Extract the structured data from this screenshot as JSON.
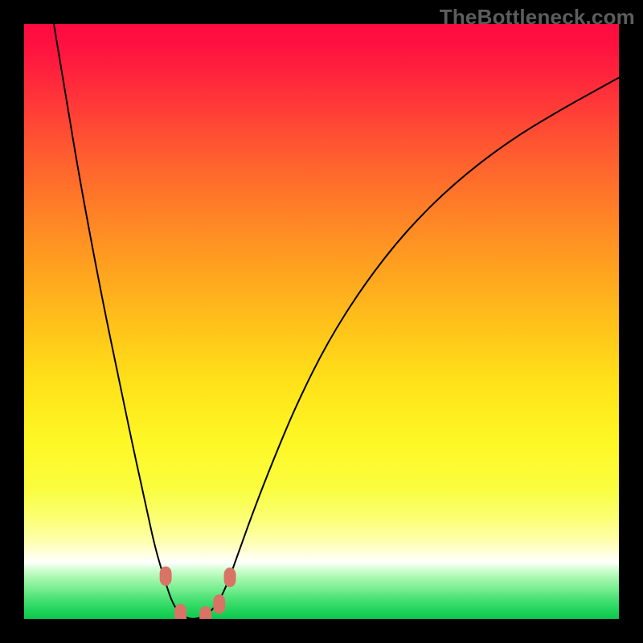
{
  "watermark": "TheBottleneck.com",
  "chart_data": {
    "type": "line",
    "title": "",
    "xlabel": "",
    "ylabel": "",
    "xlim": [
      0,
      100
    ],
    "ylim": [
      0,
      100
    ],
    "background_gradient_stops": [
      {
        "pos": 0.0,
        "color": "#ff0b40"
      },
      {
        "pos": 0.035,
        "color": "#ff1140"
      },
      {
        "pos": 0.1,
        "color": "#ff2a3b"
      },
      {
        "pos": 0.2,
        "color": "#ff5531"
      },
      {
        "pos": 0.3,
        "color": "#ff7b28"
      },
      {
        "pos": 0.4,
        "color": "#ff9e20"
      },
      {
        "pos": 0.5,
        "color": "#ffc01a"
      },
      {
        "pos": 0.6,
        "color": "#ffe119"
      },
      {
        "pos": 0.7,
        "color": "#fef725"
      },
      {
        "pos": 0.78,
        "color": "#fafd3e"
      },
      {
        "pos": 0.83,
        "color": "#fbff72"
      },
      {
        "pos": 0.87,
        "color": "#feffb0"
      },
      {
        "pos": 0.905,
        "color": "#ffffff"
      },
      {
        "pos": 0.915,
        "color": "#d7ffd8"
      },
      {
        "pos": 0.93,
        "color": "#aaf8b1"
      },
      {
        "pos": 0.948,
        "color": "#7bef93"
      },
      {
        "pos": 0.965,
        "color": "#4ee377"
      },
      {
        "pos": 0.982,
        "color": "#27d65f"
      },
      {
        "pos": 1.0,
        "color": "#0cc84c"
      }
    ],
    "series": [
      {
        "name": "bottleneck-curve",
        "x": [
          5.0,
          6.0,
          7.5,
          9.0,
          11.0,
          13.5,
          16.0,
          18.5,
          20.5,
          22.0,
          23.8,
          25.0,
          26.3,
          27.5,
          28.4,
          29.3,
          30.4,
          31.5,
          32.8,
          34.2,
          36.0,
          38.5,
          42.0,
          46.0,
          51.0,
          57.0,
          64.0,
          72.0,
          81.0,
          90.0,
          100.0
        ],
        "y": [
          100.0,
          94.0,
          85.0,
          76.0,
          65.0,
          52.0,
          40.0,
          28.0,
          19.0,
          12.0,
          6.0,
          2.5,
          0.8,
          0.1,
          0.0,
          0.1,
          0.5,
          1.4,
          3.0,
          6.0,
          11.0,
          18.0,
          27.0,
          36.5,
          46.5,
          56.0,
          65.0,
          73.0,
          80.0,
          85.5,
          91.0
        ]
      }
    ],
    "markers": [
      {
        "x": 23.8,
        "y": 7.2
      },
      {
        "x": 26.3,
        "y": 0.9
      },
      {
        "x": 30.5,
        "y": 0.5
      },
      {
        "x": 32.8,
        "y": 2.5
      },
      {
        "x": 34.6,
        "y": 7.0
      }
    ],
    "marker_color": "#d97366",
    "curve_color": "#000000"
  }
}
